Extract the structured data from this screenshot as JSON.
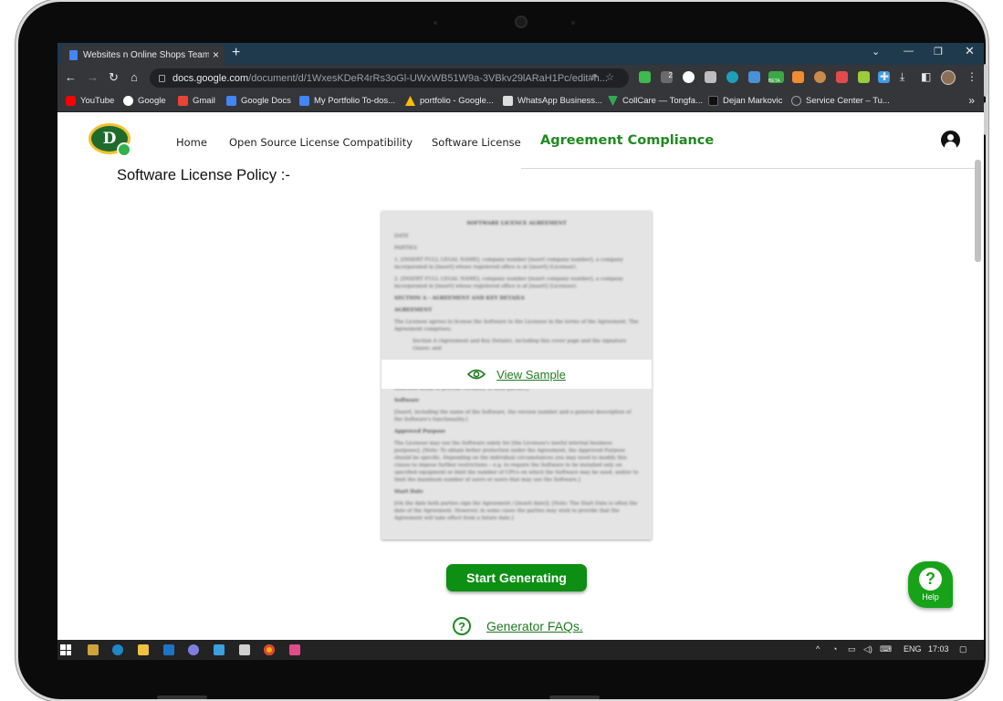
{
  "browser": {
    "tab_title": "Websites n Online Shops Team -",
    "url_host": "docs.google.com",
    "url_path": "/document/d/1WxesKDeR4rRs3oGl-UWxWB51W9a-3VBkv29lARaH1Pc/edit#h...",
    "bookmarks": [
      {
        "label": "YouTube",
        "color": "#ff0000"
      },
      {
        "label": "Google",
        "color": "#ffffff"
      },
      {
        "label": "Gmail",
        "color": "#ea4335"
      },
      {
        "label": "Google Docs",
        "color": "#4285f4"
      },
      {
        "label": "My Portfolio To-dos...",
        "color": "#4285f4"
      },
      {
        "label": "portfolio - Google...",
        "color": "#fbbc04"
      },
      {
        "label": "WhatsApp Business...",
        "color": "#dddddd"
      },
      {
        "label": "CollCare — Tongfa...",
        "color": "#34a853"
      },
      {
        "label": "Dejan Markovic",
        "color": "#111111"
      },
      {
        "label": "Service Center – Tu...",
        "color": "#9aa0a6"
      }
    ],
    "extension_badge": "2",
    "extension_beta_label": "BETA"
  },
  "site": {
    "logo_text": "D",
    "nav": {
      "home": "Home",
      "oss": "Open Source License Compatibility",
      "software_license": "Software License",
      "agreement_compliance": "Agreement Compliance"
    },
    "accent_color": "#1f8a1f"
  },
  "main": {
    "title": "Software License Policy :-",
    "doc_preview": {
      "heading": "SOFTWARE LICENCE AGREEMENT",
      "lines": [
        "DATE",
        "PARTIES",
        "1. [INSERT FULL LEGAL NAME], company number [insert company number], a company incorporated in [insert] whose registered office is at [insert] (Licensor).",
        "2. [INSERT FULL LEGAL NAME], company number [insert company number], a company incorporated in [insert] whose registered office is at [insert] (Licensee).",
        "SECTION A - AGREEMENT AND KEY DETAILS",
        "AGREEMENT",
        "The Licensor agrees to license the Software to the Licensee in the terms of the Agreement. The Agreement comprises:",
        "Section A (Agreement and Key Details), including this cover page and the signature clause; and",
        "[Note: this section should indicate all of the \"licence specific\" details relating to the Software in sufficient detail to provide certainty to both parties.]",
        "Software",
        "[Insert, including the name of the Software, the version number and a general description of the Software's functionality.]",
        "Approved Purpose",
        "The Licensee may use the Software solely for [the Licensee's lawful internal business purposes]. [Note: To obtain better protection under the Agreement, the Approved Purpose should be specific. Depending on the individual circumstances you may need to modify this clause to impose further restrictions – e.g. to require the Software to be installed only on specified equipment or limit the number of CPUs on which the Software may be used, and/or to limit the maximum number of users or users that may use the Software.]",
        "Start Date",
        "[On the date both parties sign the Agreement / [insert date]]. [Note: The Start Date is often the date of the Agreement. However, in some cases the parties may wish to provide that the Agreement will take effect from a future date.]"
      ],
      "view_label": "View Sample"
    },
    "start_button": "Start Generating",
    "faq_link": "Generator FAQs.",
    "help_label": "Help"
  },
  "taskbar": {
    "language": "ENG",
    "time": "17:03"
  }
}
